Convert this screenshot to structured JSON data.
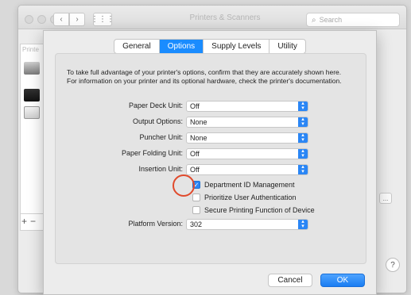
{
  "window": {
    "title": "Printers & Scanners",
    "search_placeholder": "Search",
    "printer_list_header": "Printe",
    "list_add_label": "+",
    "list_remove_label": "−",
    "side_button_label": "...",
    "help_label": "?"
  },
  "tabs": [
    {
      "label": "General",
      "active": false
    },
    {
      "label": "Options",
      "active": true
    },
    {
      "label": "Supply Levels",
      "active": false
    },
    {
      "label": "Utility",
      "active": false
    }
  ],
  "description": "To take full advantage of your printer's options, confirm that they are accurately shown here. For information on your printer and its optional hardware, check the printer's documentation.",
  "options": [
    {
      "label": "Paper Deck Unit:",
      "value": "Off"
    },
    {
      "label": "Output Options:",
      "value": "None"
    },
    {
      "label": "Puncher Unit:",
      "value": "None"
    },
    {
      "label": "Paper Folding Unit:",
      "value": "Off"
    },
    {
      "label": "Insertion Unit:",
      "value": "Off"
    }
  ],
  "checkboxes": [
    {
      "label": "Department ID Management",
      "checked": true
    },
    {
      "label": "Prioritize User Authentication",
      "checked": false
    },
    {
      "label": "Secure Printing Function of Device",
      "checked": false
    }
  ],
  "platform": {
    "label": "Platform Version:",
    "value": "302"
  },
  "buttons": {
    "cancel": "Cancel",
    "ok": "OK"
  },
  "colors": {
    "accent": "#1a8cff",
    "highlight_circle": "#e04a2c"
  }
}
